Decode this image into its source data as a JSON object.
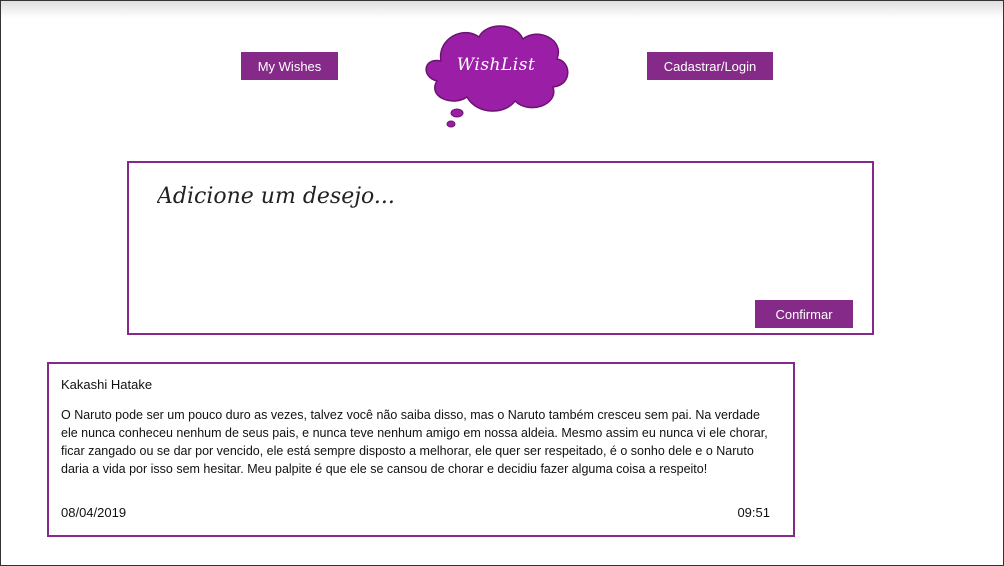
{
  "colors": {
    "accent": "#852a88",
    "logo_fill": "#9b1fa6",
    "button_text": "#ffffff",
    "background": "#ffffff"
  },
  "header": {
    "my_wishes_label": "My Wishes",
    "login_label": "Cadastrar/Login",
    "logo_text": "WishList"
  },
  "composer": {
    "placeholder": "Adicione um desejo...",
    "confirm_label": "Confirmar"
  },
  "posts": [
    {
      "author": "Kakashi Hatake",
      "text": "O Naruto pode ser um pouco duro as vezes, talvez você não saiba disso, mas o Naruto também cresceu sem pai. Na verdade ele nunca conheceu nenhum de seus pais, e nunca teve nenhum amigo em nossa aldeia. Mesmo assim eu nunca vi ele chorar, ficar zangado ou se dar por vencido, ele está sempre disposto a melhorar, ele quer ser respeitado, é o sonho dele e o Naruto daria a vida por isso sem hesitar. Meu palpite é que ele se cansou de chorar e decidiu fazer alguma coisa a respeito!",
      "date": "08/04/2019",
      "time": "09:51"
    }
  ]
}
